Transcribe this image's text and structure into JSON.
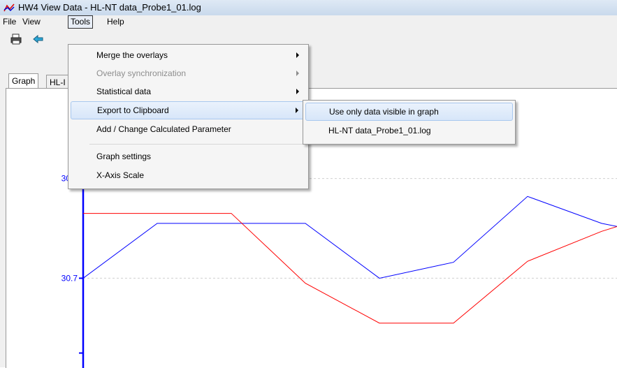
{
  "window": {
    "title": "HW4 View Data - HL-NT data_Probe1_01.log"
  },
  "menubar": {
    "file": "File",
    "view": "View",
    "tools": "Tools",
    "help": "Help"
  },
  "toolbar": {
    "print_icon": "printer-icon",
    "back_icon": "arrow-left-icon"
  },
  "tabs": [
    {
      "label": "Graph"
    },
    {
      "label": "HL-I"
    }
  ],
  "tools_menu": {
    "items": [
      {
        "label": "Merge the overlays",
        "submenu": true,
        "disabled": false
      },
      {
        "label": "Overlay synchronization",
        "submenu": true,
        "disabled": true
      },
      {
        "label": "Statistical data",
        "submenu": true,
        "disabled": false
      },
      {
        "label": "Export to Clipboard",
        "submenu": true,
        "disabled": false,
        "highlighted": true
      },
      {
        "label": "Add / Change Calculated Parameter",
        "submenu": false,
        "disabled": false
      },
      {
        "label": "Graph settings",
        "submenu": false,
        "disabled": false
      },
      {
        "label": "X-Axis Scale",
        "submenu": false,
        "disabled": false
      }
    ]
  },
  "export_submenu": {
    "items": [
      {
        "label": "Use only data visible in graph",
        "highlighted": true
      },
      {
        "label": "HL-NT data_Probe1_01.log",
        "highlighted": false
      }
    ]
  },
  "colors": {
    "axis": "#0000ff",
    "series_blue": "#0000ff",
    "series_red": "#ff0000"
  },
  "chart_data": {
    "type": "line",
    "y_ticks": [
      {
        "value": 30.8,
        "label": "30.8"
      },
      {
        "value": 30.7,
        "label": "30.7"
      }
    ],
    "ylim": [
      30.61,
      30.89
    ],
    "x": [
      0,
      1,
      2,
      3,
      4,
      5,
      6,
      7,
      8
    ],
    "xlim": [
      0,
      8.5
    ],
    "grid": true,
    "series": [
      {
        "color": "#0000ff",
        "values": [
          30.7,
          30.755,
          30.755,
          30.755,
          30.7,
          30.716,
          30.782,
          30.755,
          30.74
        ]
      },
      {
        "color": "#ff0000",
        "values": [
          30.765,
          30.765,
          30.765,
          30.695,
          30.655,
          30.655,
          30.717,
          30.747,
          30.77
        ]
      }
    ]
  }
}
